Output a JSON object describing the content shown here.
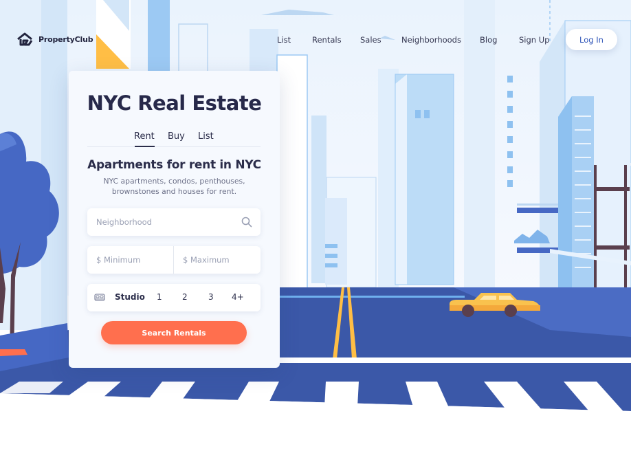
{
  "brand": {
    "name": "PropertyClub"
  },
  "nav": {
    "items": [
      {
        "label": "List"
      },
      {
        "label": "Rentals"
      },
      {
        "label": "Sales"
      },
      {
        "label": "Neighborhoods"
      },
      {
        "label": "Blog"
      },
      {
        "label": "Sign Up"
      }
    ],
    "login_label": "Log In"
  },
  "search_card": {
    "title": "NYC Real Estate",
    "tabs": [
      {
        "label": "Rent",
        "active": true
      },
      {
        "label": "Buy",
        "active": false
      },
      {
        "label": "List",
        "active": false
      }
    ],
    "heading": "Apartments for rent in NYC",
    "description_line1": "NYC apartments, condos, penthouses,",
    "description_line2": "brownstones and houses for rent.",
    "neighborhood_placeholder": "Neighborhood",
    "min_placeholder": "$ Minimum",
    "max_placeholder": "$ Maximum",
    "bedrooms": [
      "Studio",
      "1",
      "2",
      "3",
      "4+"
    ],
    "submit_label": "Search Rentals"
  },
  "icons": {
    "logo": "house-logo-icon",
    "search": "search-icon",
    "bed": "bed-icon"
  },
  "colors": {
    "accent": "#ff6f4e",
    "link": "#2f55b8",
    "street": "#3b58a8",
    "taxi": "#f9c24e",
    "tree": "#4668c4"
  }
}
